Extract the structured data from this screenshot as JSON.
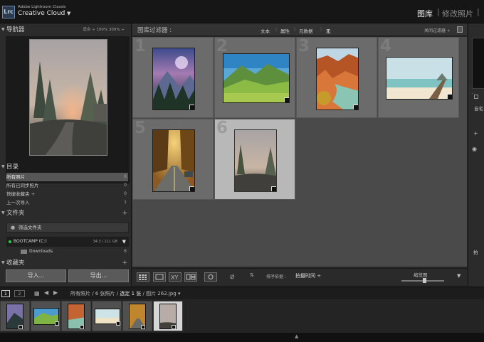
{
  "header": {
    "app_badge": "Lrc",
    "product_small": "Adobe Lightroom Classic",
    "product_big": "Creative Cloud",
    "modules": [
      "图库",
      "修改照片"
    ],
    "separator": "|"
  },
  "navigator": {
    "title": "导航器",
    "zoom_options": "适合 ÷   100%   300% ÷"
  },
  "catalog": {
    "title": "目录",
    "items": [
      {
        "label": "所有照片",
        "count": "6"
      },
      {
        "label": "所有已同步照片",
        "count": "0"
      },
      {
        "label": "快捷收藏夹 +",
        "count": "0"
      },
      {
        "label": "上一次导入",
        "count": "1"
      }
    ]
  },
  "folders": {
    "title": "文件夹",
    "plus": "+",
    "filter_placeholder": "筛选文件夹",
    "volume": {
      "name": "BOOTCAMP (C:)",
      "size": "34.3 / 111 GB",
      "arrow": "▼"
    },
    "folder": {
      "name": "Downloads",
      "count": "6"
    }
  },
  "collections": {
    "title": "收藏夹",
    "plus": "+"
  },
  "buttons": {
    "import": "导入...",
    "export": "导出..."
  },
  "filter_bar": {
    "title": "图库过滤器 :",
    "tabs": [
      "文本",
      "属性",
      "元数据",
      "无"
    ],
    "off": "关闭过滤器 ÷"
  },
  "grid": {
    "cells": [
      {
        "index": "1",
        "photo": "mountain-night"
      },
      {
        "index": "2",
        "photo": "green-valley"
      },
      {
        "index": "3",
        "photo": "red-canyon"
      },
      {
        "index": "4",
        "photo": "beach-pier"
      },
      {
        "index": "5",
        "photo": "autumn-road"
      },
      {
        "index": "6",
        "photo": "foggy-forest",
        "selected": true
      }
    ]
  },
  "toolbar": {
    "sort_label": "排序依据 :",
    "sort_value": "拍摄时间 ÷",
    "thumb_label": "缩览图"
  },
  "secondary_bar": {
    "tab1": "1",
    "tab2": "2",
    "path_prefix": "所有照片",
    "path_sep": "/",
    "photo_count": "6 张照片",
    "selected": "选定 1 张",
    "file": "图片 262.jpg"
  },
  "right_panel": {
    "auto": "自宅",
    "bottom": "拍"
  },
  "colors": {
    "accent_green": "#2fcf3a",
    "selected_cell": "#b8b8b8",
    "grid_bg": "#4a4a4a"
  }
}
